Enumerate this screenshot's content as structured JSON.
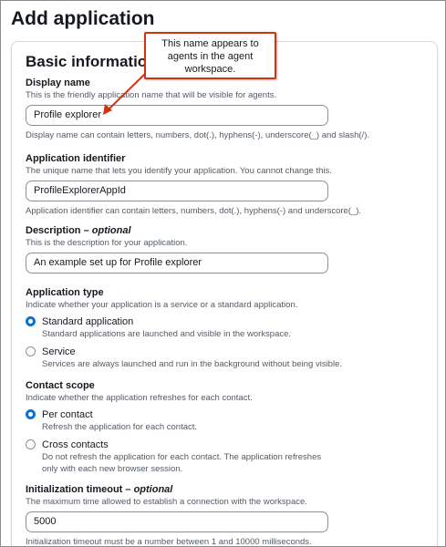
{
  "page": {
    "title": "Add application"
  },
  "panel": {
    "title": "Basic information"
  },
  "display_name": {
    "label": "Display name",
    "description": "This is the friendly application name that will be visible for agents.",
    "value": "Profile explorer",
    "constraint": "Display name can contain letters, numbers, dot(.), hyphens(-), underscore(_) and slash(/)."
  },
  "app_identifier": {
    "label": "Application identifier",
    "description": "The unique name that lets you identify your application. You cannot change this.",
    "value": "ProfileExplorerAppId",
    "constraint": "Application identifier can contain letters, numbers, dot(.), hyphens(-) and underscore(_)."
  },
  "description_field": {
    "label": "Description",
    "optional": "optional",
    "description": "This is the description for your application.",
    "value": "An example set up for Profile explorer"
  },
  "app_type": {
    "label": "Application type",
    "description": "Indicate whether your application is a service or a standard application.",
    "options": [
      {
        "label": "Standard application",
        "description": "Standard applications are launched and visible in the workspace.",
        "selected": true
      },
      {
        "label": "Service",
        "description": "Services are always launched and run in the background without being visible.",
        "selected": false
      }
    ]
  },
  "contact_scope": {
    "label": "Contact scope",
    "description": "Indicate whether the application refreshes for each contact.",
    "options": [
      {
        "label": "Per contact",
        "description": "Refresh the application for each contact.",
        "selected": true
      },
      {
        "label": "Cross contacts",
        "description": "Do not refresh the application for each contact. The application refreshes only with each new browser session.",
        "selected": false
      }
    ]
  },
  "init_timeout": {
    "label": "Initialization timeout",
    "optional": "optional",
    "description": "The maximum time allowed to establish a connection with the workspace.",
    "value": "5000",
    "constraint": "Initialization timeout must be a number between 1 and 10000 milliseconds."
  },
  "callout": {
    "text": "This name appears to agents in the agent workspace."
  },
  "colors": {
    "accent": "#0972d3",
    "callout_border": "#d13212",
    "arrow": "#d13212"
  }
}
